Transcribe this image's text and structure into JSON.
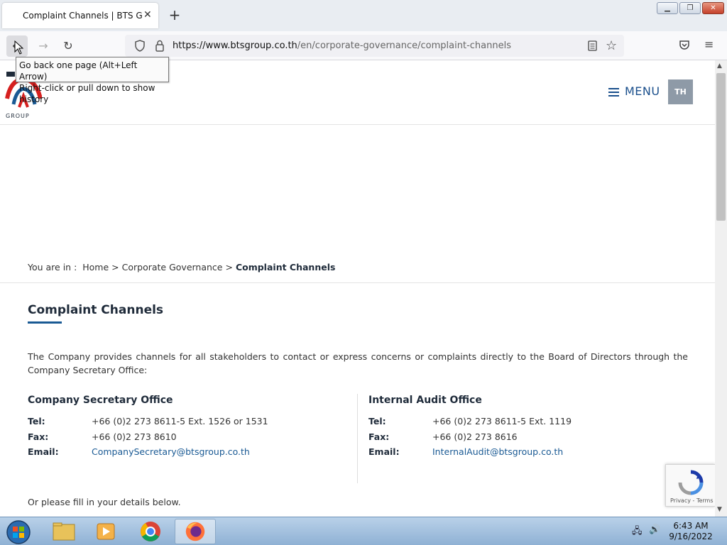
{
  "browser": {
    "tab_title": "Complaint Channels | BTS Group",
    "url_domain": "https://www.btsgroup.co.th",
    "url_path": "/en/corporate-governance/complaint-channels",
    "tooltip_line1": "Go back one page (Alt+Left Arrow)",
    "tooltip_line2": "Right-click or pull down to show history"
  },
  "site": {
    "logo_text": "GROUP",
    "menu_label": "MENU",
    "lang_label": "TH"
  },
  "breadcrumb": {
    "prefix": "You are in :",
    "home": "Home",
    "sep1": ">",
    "section": "Corporate Governance",
    "sep2": ">",
    "current": "Complaint Channels"
  },
  "main": {
    "title": "Complaint Channels",
    "intro": "The Company provides channels for all stakeholders to contact or express concerns or complaints directly to the Board of Directors through the Company Secretary Office:",
    "offices": [
      {
        "name": "Company Secretary Office",
        "tel_label": "Tel:",
        "tel": "+66 (0)2 273 8611-5 Ext. 1526 or 1531",
        "fax_label": "Fax:",
        "fax": "+66 (0)2 273 8610",
        "email_label": "Email:",
        "email": "CompanySecretary@btsgroup.co.th"
      },
      {
        "name": "Internal Audit Office",
        "tel_label": "Tel:",
        "tel": "+66 (0)2 273 8611-5 Ext. 1119",
        "fax_label": "Fax:",
        "fax": "+66 (0)2 273 8616",
        "email_label": "Email:",
        "email": "InternalAudit@btsgroup.co.th"
      }
    ],
    "fill_text": "Or please fill in your details below."
  },
  "recaptcha": {
    "terms": "Privacy - Terms"
  },
  "taskbar": {
    "time": "6:43 AM",
    "date": "9/16/2022"
  },
  "colors": {
    "brand_blue": "#1a5a94",
    "brand_red": "#d6201f",
    "lang_bg": "#8e9aa7"
  }
}
